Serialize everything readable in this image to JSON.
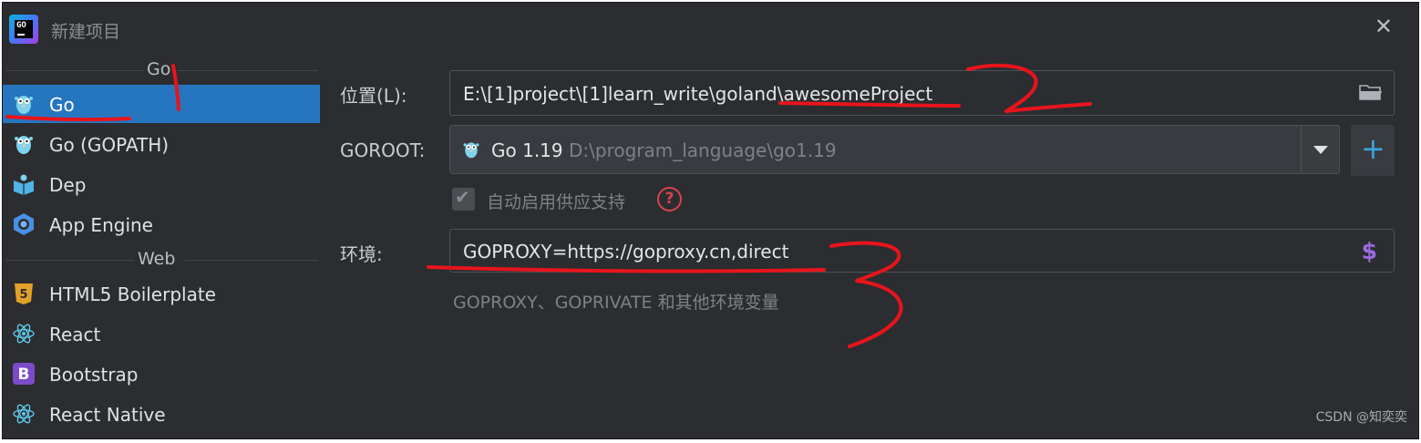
{
  "window": {
    "title": "新建项目",
    "close_glyph": "✕"
  },
  "sidebar": {
    "sections": [
      {
        "label": "Go",
        "items": [
          {
            "label": "Go",
            "icon": "gopher-icon",
            "selected": true
          },
          {
            "label": "Go (GOPATH)",
            "icon": "gopher-icon",
            "selected": false
          },
          {
            "label": "Dep",
            "icon": "dep-icon",
            "selected": false
          },
          {
            "label": "App Engine",
            "icon": "app-engine-icon",
            "selected": false
          }
        ]
      },
      {
        "label": "Web",
        "items": [
          {
            "label": "HTML5 Boilerplate",
            "icon": "html5-icon",
            "selected": false
          },
          {
            "label": "React",
            "icon": "react-icon",
            "selected": false
          },
          {
            "label": "Bootstrap",
            "icon": "bootstrap-icon",
            "selected": false
          },
          {
            "label": "React Native",
            "icon": "react-icon",
            "selected": false
          }
        ]
      }
    ]
  },
  "form": {
    "location": {
      "label": "位置(L):",
      "value": "E:\\[1]project\\[1]learn_write\\goland\\awesomeProject"
    },
    "goroot": {
      "label": "GOROOT:",
      "version": "Go 1.19",
      "path": "D:\\program_language\\go1.19"
    },
    "vendoring": {
      "label": "自动启用供应支持",
      "checked": true
    },
    "environment": {
      "label": "环境:",
      "value": "GOPROXY=https://goproxy.cn,direct",
      "hint": "GOPROXY、GOPRIVATE 和其他环境变量"
    },
    "add_glyph": "+"
  },
  "watermark": "CSDN @知奕奕",
  "colors": {
    "selection": "#2675bf",
    "background": "#2b2d30",
    "annotation": "#e8141c",
    "accent_blue": "#3aa7e0",
    "help_red": "#d9434c"
  }
}
